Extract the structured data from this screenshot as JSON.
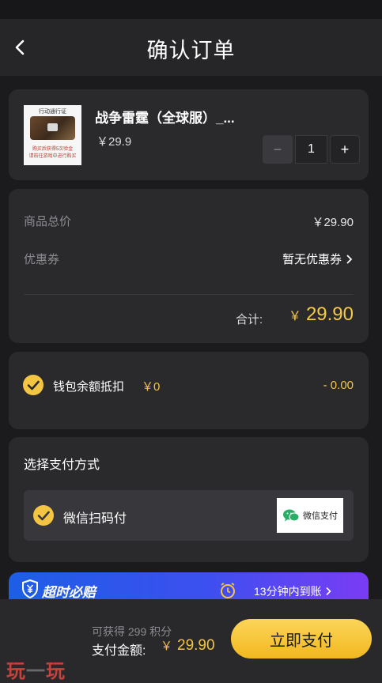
{
  "header": {
    "title": "确认订单",
    "back_icon": "chevron-left-icon"
  },
  "product": {
    "name": "战争雷霆（全球服）_...",
    "price": "￥29.9",
    "thumbnail": {
      "title": "行动通行证",
      "caption_line1": "购买后获得5次验金",
      "caption_line2": "请前往游戏中进行购买"
    },
    "quantity": "1",
    "minus_label": "−",
    "plus_label": "+"
  },
  "summary": {
    "subtotal_label": "商品总价",
    "subtotal_value": "￥29.90",
    "coupon_label": "优惠券",
    "coupon_value": "暂无优惠券",
    "total_label": "合计:",
    "total_currency": "￥",
    "total_value": "29.90"
  },
  "wallet": {
    "label": "钱包余额抵扣",
    "balance": "￥0",
    "deduction": "- 0.00"
  },
  "payment": {
    "title": "选择支付方式",
    "method_label": "微信扫码付",
    "badge_text": "微信支付"
  },
  "promo": {
    "left_text": "超时必赔",
    "right_text": "13分钟内到账"
  },
  "bottom_bar": {
    "points_text": "可获得 299 积分",
    "amount_label": "支付金额:",
    "amount_currency": "￥",
    "amount_value": "29.90",
    "pay_button": "立即支付"
  },
  "watermark": {
    "part1": "玩",
    "dash": "一",
    "part2": "玩"
  },
  "colors": {
    "accent": "#f4c542",
    "background": "#1b1b1e",
    "card": "#2a2a2d",
    "promo_start": "#1d5ee6",
    "promo_end": "#7a3cf5"
  }
}
